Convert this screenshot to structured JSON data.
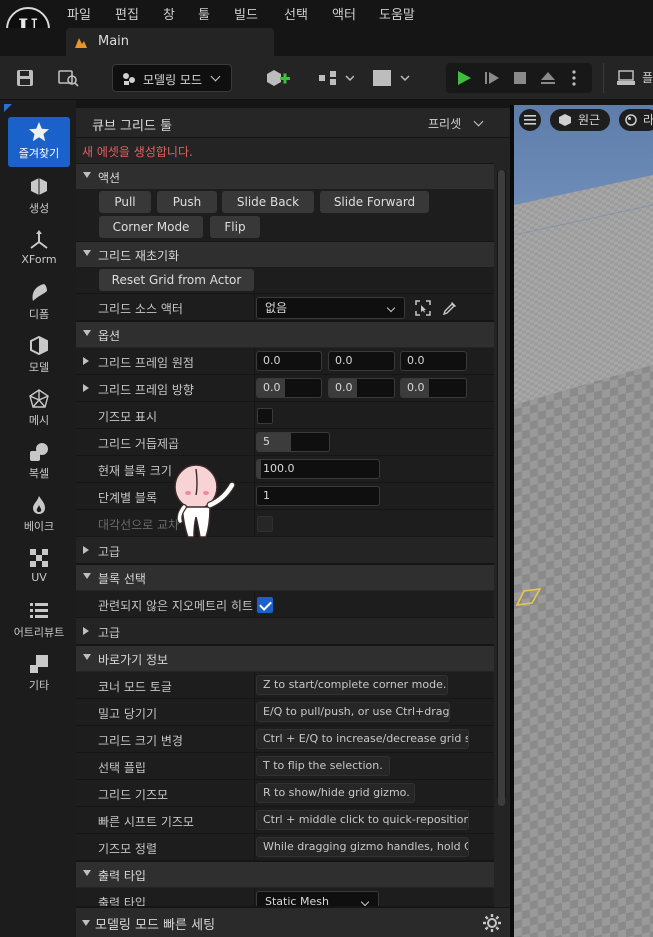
{
  "menu": [
    "파일",
    "편집",
    "창",
    "툴",
    "빌드",
    "선택",
    "액터",
    "도움말"
  ],
  "tab": {
    "label": "Main"
  },
  "toolbar": {
    "mode_label": "모델링 모드",
    "right_label": "플"
  },
  "modes": [
    {
      "label": "즐겨찾기",
      "icon": "star-icon"
    },
    {
      "label": "생성",
      "icon": "create-icon"
    },
    {
      "label": "XForm",
      "icon": "xform-icon"
    },
    {
      "label": "디폼",
      "icon": "deform-icon"
    },
    {
      "label": "모델",
      "icon": "model-icon"
    },
    {
      "label": "메시",
      "icon": "mesh-icon"
    },
    {
      "label": "복셀",
      "icon": "voxel-icon"
    },
    {
      "label": "베이크",
      "icon": "bake-icon"
    },
    {
      "label": "UV",
      "icon": "uv-icon"
    },
    {
      "label": "어트리뷰트",
      "icon": "attributes-icon"
    },
    {
      "label": "기타",
      "icon": "misc-icon"
    }
  ],
  "panel": {
    "title": "큐브 그리드 툴",
    "preset": "프리셋",
    "warning": "새 에셋을 생성합니다."
  },
  "sections": {
    "actions": "액션",
    "grid_repos": "그리드 재초기화",
    "options": "옵션",
    "advanced": "고급",
    "block_select": "블록 선택",
    "advanced2": "고급",
    "shortcuts": "바로가기 정보",
    "output_type": "출력 타입"
  },
  "actions": [
    "Pull",
    "Push",
    "Slide Back",
    "Slide Forward",
    "Corner Mode",
    "Flip"
  ],
  "grid": {
    "reset_btn": "Reset Grid from Actor",
    "source_label": "그리드 소스 액터",
    "source_value": "없음"
  },
  "options": {
    "frame_origin": {
      "label": "그리드 프레임 원점",
      "values": [
        "0.0",
        "0.0",
        "0.0"
      ]
    },
    "frame_orient": {
      "label": "그리드 프레임 방향",
      "values": [
        "0.0",
        "0.0",
        "0.0"
      ]
    },
    "show_gizmo": {
      "label": "기즈모 표시"
    },
    "grid_power": {
      "label": "그리드 거듭제곱",
      "value": "5"
    },
    "block_size": {
      "label": "현재 블록 크기",
      "value": "100.0"
    },
    "block_steps": {
      "label": "단계별 블록",
      "value": "1"
    },
    "diag_cross": {
      "label": "대각선으로 교차"
    }
  },
  "block_select": {
    "label": "관련되지 않은 지오메트리 히트"
  },
  "shortcuts": [
    {
      "label": "코너 모드 토글",
      "hint": "Z to start/complete corner mode."
    },
    {
      "label": "밀고 당기기",
      "hint": "E/Q to pull/push, or use Ctrl+drag."
    },
    {
      "label": "그리드 크기 변경",
      "hint": "Ctrl + E/Q to increase/decrease grid s"
    },
    {
      "label": "선택 플립",
      "hint": "T to flip the selection."
    },
    {
      "label": "그리드 기즈모",
      "hint": "R to show/hide grid gizmo."
    },
    {
      "label": "빠른 시프트 기즈모",
      "hint": "Ctrl + middle click to quick-reposition"
    },
    {
      "label": "기즈모 정렬",
      "hint": "While dragging gizmo handles, hold Ct"
    }
  ],
  "output": {
    "label": "출력 타입",
    "value": "Static Mesh"
  },
  "quick_settings": "모델링 모드 빠른 세팅",
  "viewport": {
    "perspective": "원근",
    "lit": "라"
  },
  "colors": {
    "accent": "#1a62c9",
    "warning": "#e06060",
    "play": "#3dbf3d"
  }
}
